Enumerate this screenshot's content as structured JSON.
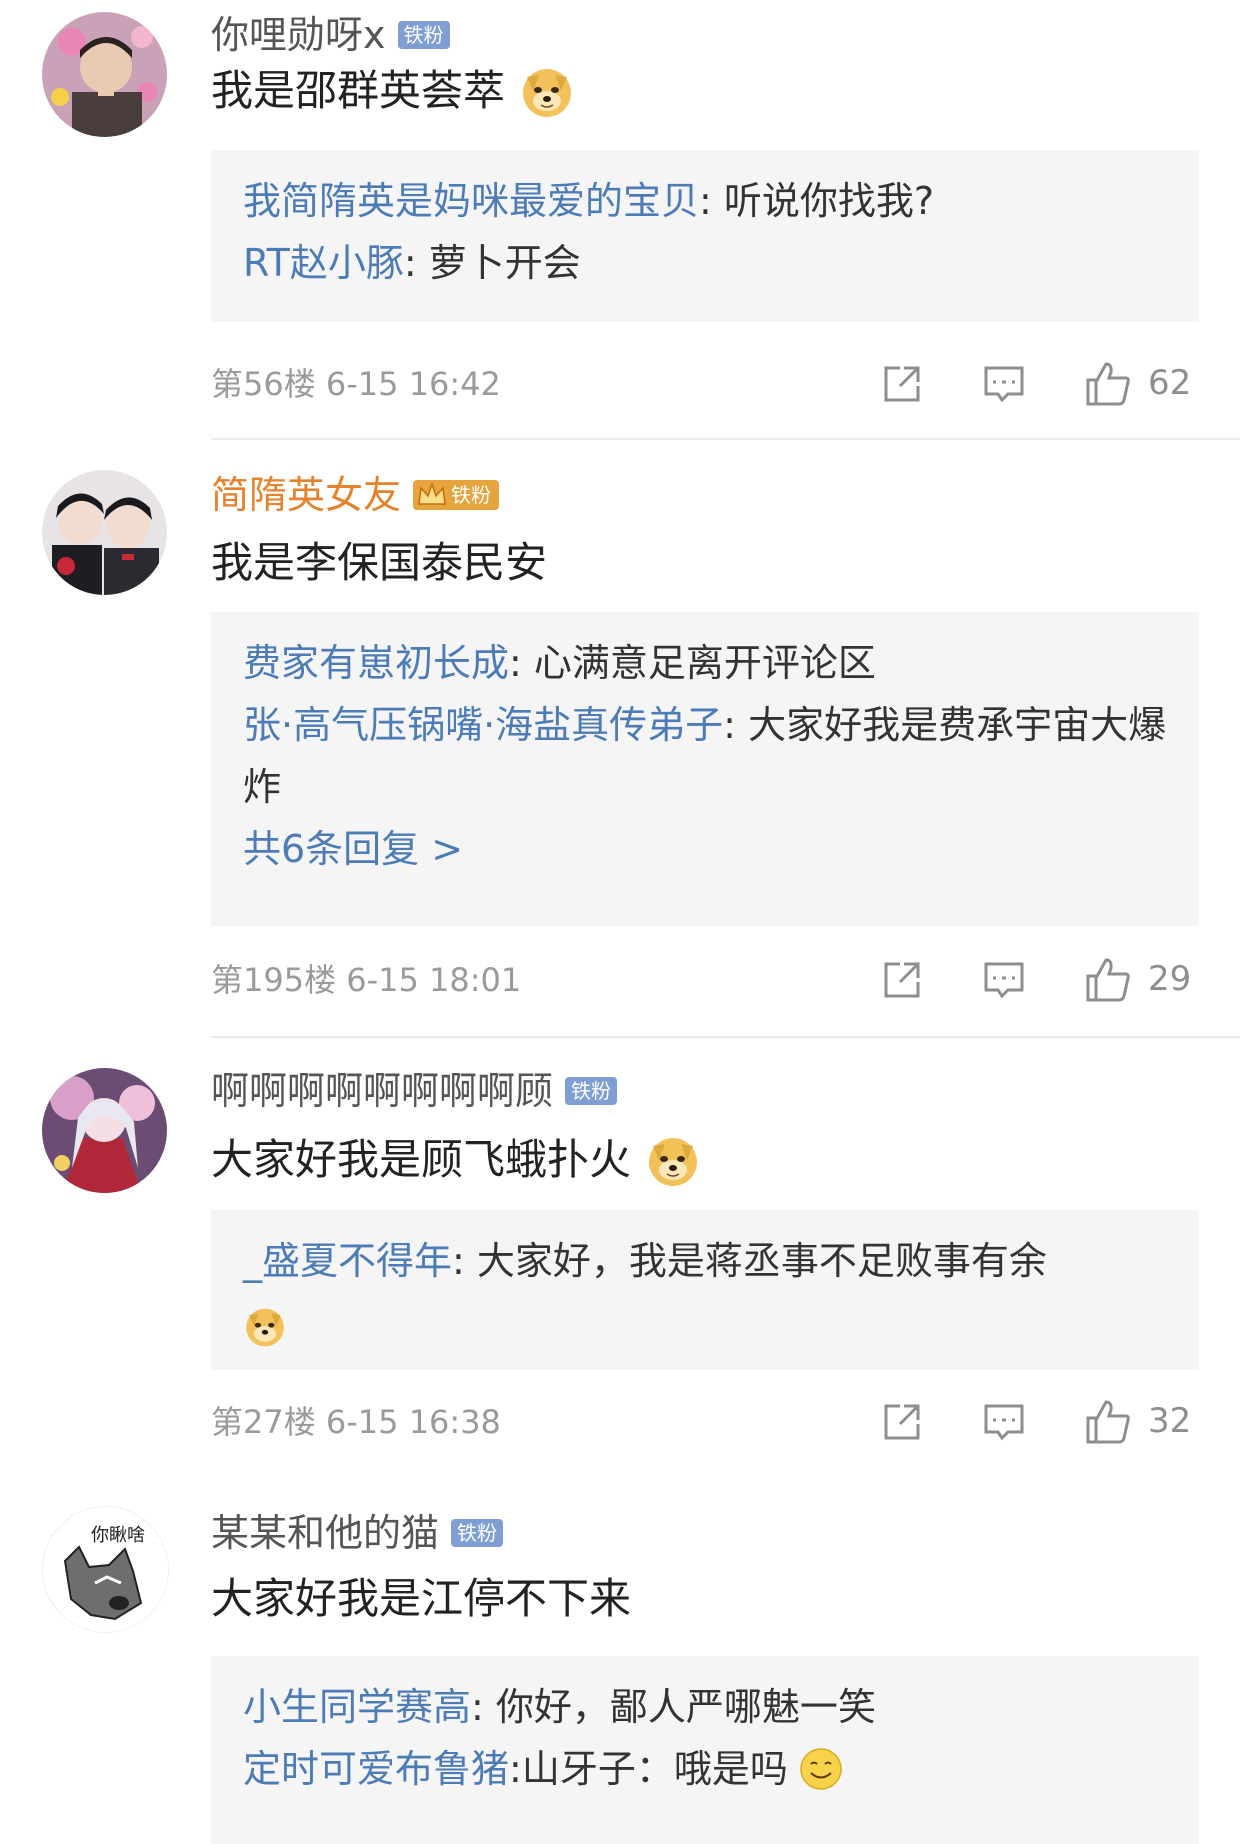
{
  "comments": [
    {
      "username": "你哩勋呀x",
      "badge": "铁粉",
      "text": "我是邵群英荟萃",
      "emoji": "doge-emoji",
      "replies": [
        {
          "user": "我简隋英是妈咪最爱的宝贝",
          "sep": ": ",
          "text": "听说你找我?"
        },
        {
          "user": "RT赵小豚",
          "sep": ": ",
          "text": "萝卜开会"
        }
      ],
      "meta": "第56楼 6-15 16:42",
      "likes": "62"
    },
    {
      "username": "简隋英女友",
      "badge": "铁粉",
      "text": "我是李保国泰民安",
      "replies": [
        {
          "user": "费家有崽初长成",
          "sep": ": ",
          "text": "心满意足离开评论区"
        },
        {
          "user": "张·高气压锅嘴·海盐真传弟子",
          "sep": ": ",
          "text": "大家好我是费承宇宙大爆炸"
        }
      ],
      "more": "共6条回复 >",
      "meta": "第195楼 6-15 18:01",
      "likes": "29"
    },
    {
      "username": "啊啊啊啊啊啊啊啊顾",
      "badge": "铁粉",
      "text": "大家好我是顾飞蛾扑火",
      "emoji": "doge-emoji",
      "replies": [
        {
          "user": "_盛夏不得年",
          "sep": ": ",
          "text": "大家好，我是蒋丞事不足败事有余"
        }
      ],
      "meta": "第27楼 6-15 16:38",
      "likes": "32"
    },
    {
      "username": "某某和他的猫",
      "badge": "铁粉",
      "avatar_text": "你瞅啥",
      "text": "大家好我是江停不下来",
      "replies": [
        {
          "user": "小生同学赛高",
          "sep": ": ",
          "text": "你好，鄙人严哪魅一笑"
        },
        {
          "user": "定时可爱布鲁猪",
          "sep": ": ",
          "text": "山牙子：哦是吗"
        }
      ]
    }
  ],
  "colors": {
    "reply_user": "#4d7bb6",
    "badge": "#7f9fd3",
    "crown_badge": "#e6a53c",
    "reply_bg": "#f5f5f6",
    "meta": "#9a9a9a"
  }
}
